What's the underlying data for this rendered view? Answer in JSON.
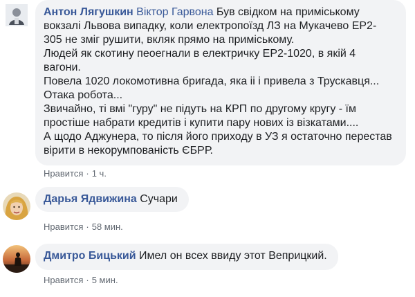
{
  "comments": [
    {
      "author": "Антон Лягушкин",
      "mention": "Віктор Гарвона",
      "first_line_rest": "Був свідком на приміському",
      "lines": [
        "вокзалі Львова випадку, коли електропоїзд ЛЗ на Мукачево ЕР2-",
        "305 не зміг рушити, вкляк прямо на приміському.",
        "Людей як скотину пеоегнали в електричку ЕР2-1020, в якій 4",
        "вагони.",
        "Повела 1020 локомотивна бригада, яка іі і привела з Трускавця...",
        "Отака робота...",
        "Звичайно, ті вмі \"гуру\" не підуть на КРП по другому кругу - їм",
        "простіше набрати кредитів і купити пару нових із візкатами....",
        "А щодо Аджунера, то після його приходу в УЗ я остаточно перестав",
        "вірити в некорумпованість ЄБРР."
      ],
      "like_label": "Нравится",
      "time": "1 ч."
    },
    {
      "author": "Дарья Ядвижина",
      "text": "Сучари",
      "like_label": "Нравится",
      "time": "58 мин."
    },
    {
      "author": "Дмитро Бицький",
      "text": "Имел он всех ввиду этот Веприцкий.",
      "like_label": "Нравится",
      "time": "5 мин."
    }
  ],
  "separator": "·"
}
